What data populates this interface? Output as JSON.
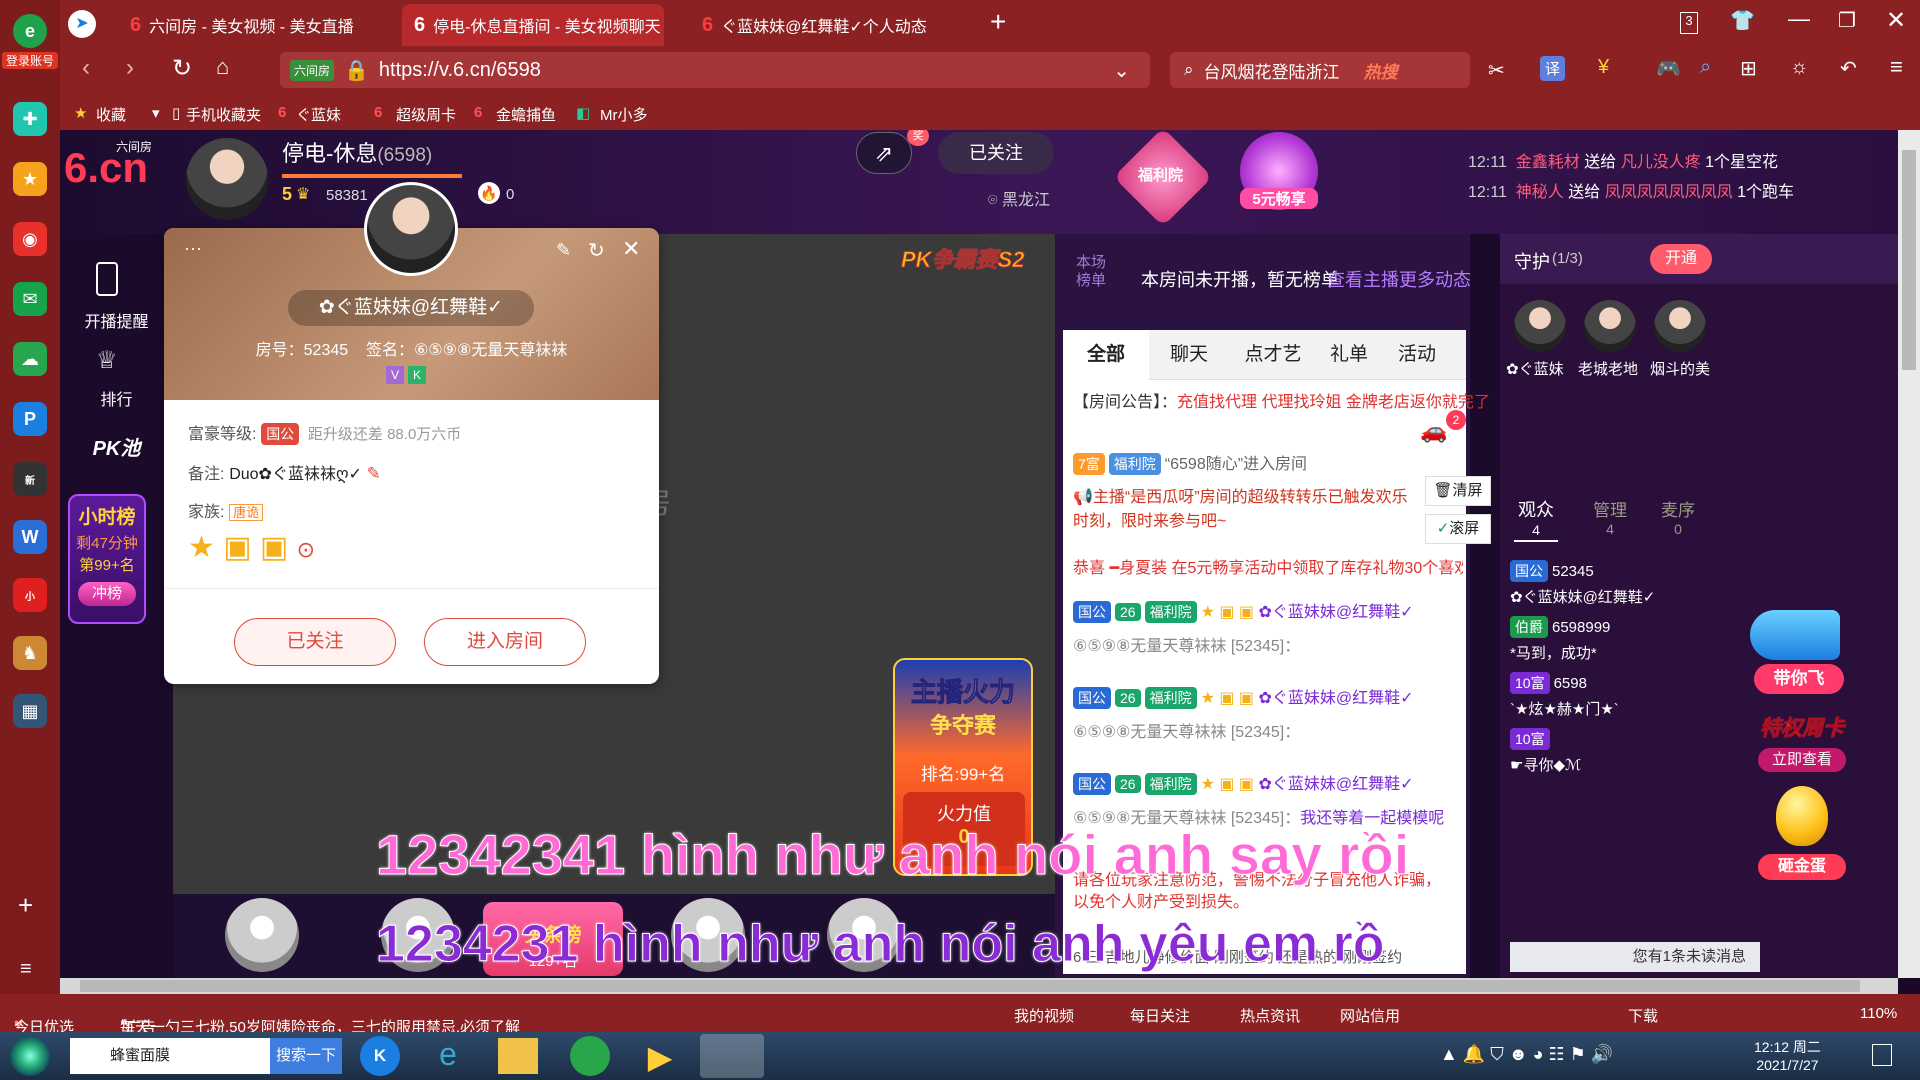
{
  "browser": {
    "login_badge": "登录账号",
    "tabs": [
      {
        "label": "六间房 - 美女视频 - 美女直播"
      },
      {
        "label": "停电-休息直播间 - 美女视频聊天"
      },
      {
        "label": "ぐ蓝妹妹@红舞鞋✓个人动态"
      }
    ],
    "tab_count": "3",
    "url": "https://v.6.cn/6598",
    "url_prefix": "六间房",
    "search_text": "台风烟花登陆浙江",
    "search_hot": "热搜",
    "translate": "译",
    "bookmarks": [
      "收藏",
      "手机收藏夹",
      "ぐ蓝妹",
      "超级周卡",
      "金蟾捕鱼",
      "Mr小多"
    ]
  },
  "room": {
    "logo_top": "六间房",
    "logo": "6.cn",
    "host_name": "停电-休息",
    "room_id": "(6598)",
    "level": "5",
    "fans": "58381",
    "heat": "0",
    "share_badge": "奖",
    "follow_label": "已关注",
    "location": "黑龙江",
    "welfare": "福利院",
    "five_yuan": "5元畅享",
    "gifts": [
      {
        "time": "12:11",
        "from": "金鑫耗材",
        "verb": "送给",
        "to": "凡儿没人疼",
        "gift": "1个星空花"
      },
      {
        "time": "12:11",
        "from": "神秘人",
        "verb": "送给",
        "to": "凤凤凤凤凤凤凤凤",
        "gift": "1个跑车"
      }
    ]
  },
  "leftnav": [
    {
      "label": "开播提醒"
    },
    {
      "label": "排行"
    },
    {
      "label": "PK池"
    }
  ],
  "hourly": {
    "title": "小时榜",
    "remain": "剩47分钟",
    "rank": "第99+名",
    "button": "冲榜"
  },
  "popup": {
    "name": "✿ぐ蓝妹妹@红舞鞋✓",
    "room_no": "房号：52345",
    "sign": "签名：⑥⑤⑨⑧无量天尊袜袜",
    "wealth_label": "富豪等级:",
    "wealth_tag": "国公",
    "wealth_next": "距升级还差 88.0万六币",
    "remark_label": "备注:",
    "remark": "Duo✿ぐ蓝袜袜ღ✓",
    "family_label": "家族:",
    "family": "唐诡",
    "btn_follow": "已关注",
    "btn_enter": "进入房间"
  },
  "video": {
    "pk": "PK争霸赛S2",
    "watermark_a": "间房",
    "watermark_b": "n",
    "watermark_c": "播",
    "fire_title_a": "主播火力",
    "fire_title_b": "争夺赛",
    "rank": "排名:99+名",
    "fire_label": "火力值",
    "fire_value": "0",
    "headline": "头条榜",
    "headline_rank": "129+名"
  },
  "chatpanel": {
    "rank_label": "本场榜单",
    "no_rank": "本房间未开播，暂无榜单",
    "more": "查看主播更多动态",
    "tabs": [
      "全部",
      "聊天",
      "点才艺",
      "礼单",
      "活动"
    ],
    "car_badge": "2",
    "notice_label": "【房间公告】：",
    "notice": "充值找代理 代理找玲姐 金牌老店返你就完了",
    "enter_tag": "7富",
    "enter_tag2": "福利院",
    "enter_text": "“6598随心”进入房间",
    "announce": "主播“是西瓜呀”房间的超级转转乐已触发欢乐时刻，限时来参与吧~",
    "clear": "清屏",
    "scroll": "滚屏",
    "congrats": "恭喜 ━身夏装 在5元畅享活动中领取了库存礼物30个喜欢你。点击参与~",
    "msg_user": "✿ぐ蓝妹妹@红舞鞋✓",
    "msg_tag": "国公",
    "msg_num": "26",
    "msg_welfare": "福利院",
    "msg_text": "⑥⑤⑨⑧无量天尊袜袜 [52345]：",
    "last_text": "我还等着一起模模呢",
    "warning": "请各位玩家注意防范，警惕不法分子冒充他人诈骗，以免个人财产受到损失。",
    "bottom_text": "6 三 吉地儿静修价面  刚刚签约   还是热的             刚刚签约"
  },
  "rightpanel": {
    "guard": "守护",
    "guard_count": "(1/3)",
    "open": "开通",
    "guards": [
      "✿ぐ蓝妹",
      "老城老地",
      "烟斗的美"
    ],
    "tabs": [
      {
        "label": "观众",
        "count": "4"
      },
      {
        "label": "管理",
        "count": "4"
      },
      {
        "label": "麦序",
        "count": "0"
      }
    ],
    "users": [
      {
        "tag": "国公",
        "id": "52345",
        "name": "✿ぐ蓝妹妹@红舞鞋✓"
      },
      {
        "tag": "伯爵",
        "id": "6598999",
        "name": "*马到，成功*"
      },
      {
        "tag": "10富",
        "id": "6598",
        "name": "`★炫★赫★门★`"
      },
      {
        "tag": "10富",
        "id": "",
        "name": "☛寻你◆ℳ"
      }
    ],
    "fly": "带你飞",
    "card": "特权周卡",
    "card_btn": "立即查看",
    "egg": "砸金蛋",
    "unread": "您有1条未读消息"
  },
  "subtitles": [
    "12342341  hình như anh nói anh say rồi",
    "1234231  hình như anh nói anh yêu em rồ"
  ],
  "statusbar": {
    "today": "今日优选",
    "news": "每天一勺三七粉,50岁阿姨险丧命，三七的服用禁忌,必须了解",
    "ad": "广告",
    "items": [
      "我的视频",
      "每日关注",
      "热点资讯",
      "网站信用",
      "下载"
    ],
    "zoom": "110%"
  },
  "taskbar": {
    "app": "蜂蜜面膜",
    "search": "搜索一下",
    "time": "12:12 周二",
    "date": "2021/7/27"
  },
  "colors": {
    "browser": "#8b2122",
    "accent": "#ff4d6d",
    "gold": "#ffd23a",
    "link": "#7a2bd6"
  }
}
